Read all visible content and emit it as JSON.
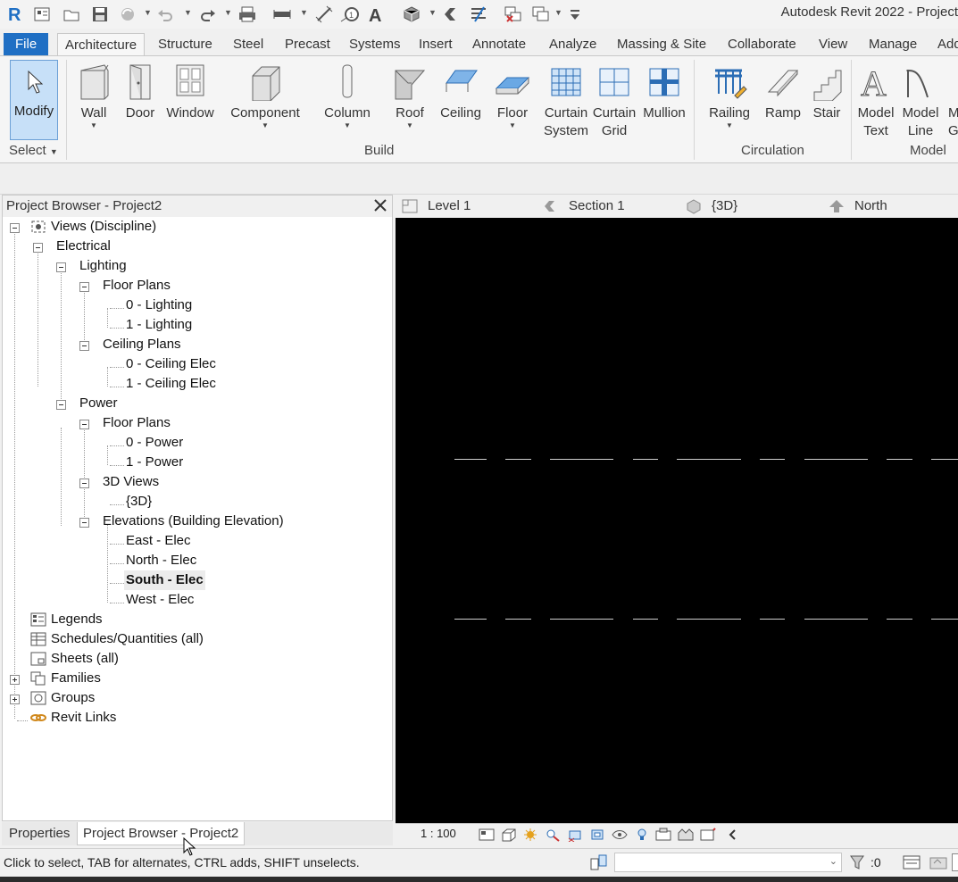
{
  "app": {
    "title": "Autodesk Revit 2022 - Project"
  },
  "ribbon_tabs": [
    "File",
    "Architecture",
    "Structure",
    "Steel",
    "Precast",
    "Systems",
    "Insert",
    "Annotate",
    "Analyze",
    "Massing & Site",
    "Collaborate",
    "View",
    "Manage",
    "Add"
  ],
  "ribbon": {
    "modify": "Modify",
    "select_panel": "Select",
    "build_panel": "Build",
    "circulation_panel": "Circulation",
    "model_panel": "Model",
    "wall": "Wall",
    "door": "Door",
    "window": "Window",
    "component": "Component",
    "column": "Column",
    "roof": "Roof",
    "ceiling": "Ceiling",
    "floor": "Floor",
    "curtain_system_1": "Curtain",
    "curtain_system_2": "System",
    "curtain_grid_1": "Curtain",
    "curtain_grid_2": "Grid",
    "mullion": "Mullion",
    "railing": "Railing",
    "ramp": "Ramp",
    "stair": "Stair",
    "model_text_1": "Model",
    "model_text_2": "Text",
    "model_line_1": "Model",
    "model_line_2": "Line",
    "model_group_1": "M",
    "model_group_2": "G"
  },
  "project_browser": {
    "title": "Project Browser - Project2",
    "tree": {
      "views": "Views (Discipline)",
      "electrical": "Electrical",
      "lighting": "Lighting",
      "floor_plans": "Floor Plans",
      "lighting_0": "0 - Lighting",
      "lighting_1": "1 - Lighting",
      "ceiling_plans": "Ceiling Plans",
      "ceiling_0": "0 - Ceiling Elec",
      "ceiling_1": "1 - Ceiling Elec",
      "power": "Power",
      "power_floor_plans": "Floor Plans",
      "power_0": "0 - Power",
      "power_1": "1 - Power",
      "views_3d": "3D Views",
      "view_3d": "{3D}",
      "elevations": "Elevations (Building Elevation)",
      "east": "East - Elec",
      "north": "North - Elec",
      "south": "South - Elec",
      "west": "West - Elec",
      "legends": "Legends",
      "schedules": "Schedules/Quantities (all)",
      "sheets": "Sheets (all)",
      "families": "Families",
      "groups": "Groups",
      "revit_links": "Revit Links"
    }
  },
  "bottom_tabs": {
    "properties": "Properties",
    "project_browser": "Project Browser - Project2"
  },
  "view_tabs": [
    "Level 1",
    "Section 1",
    "{3D}",
    "North"
  ],
  "view_control": {
    "scale": "1 : 100"
  },
  "status": {
    "hint": "Click to select, TAB for alternates, CTRL adds, SHIFT unselects.",
    "filter_count": ":0"
  },
  "colors": {
    "file_tab": "#1f6fc4",
    "canvas": "#000000",
    "modify_highlight": "#c7e0f8"
  }
}
